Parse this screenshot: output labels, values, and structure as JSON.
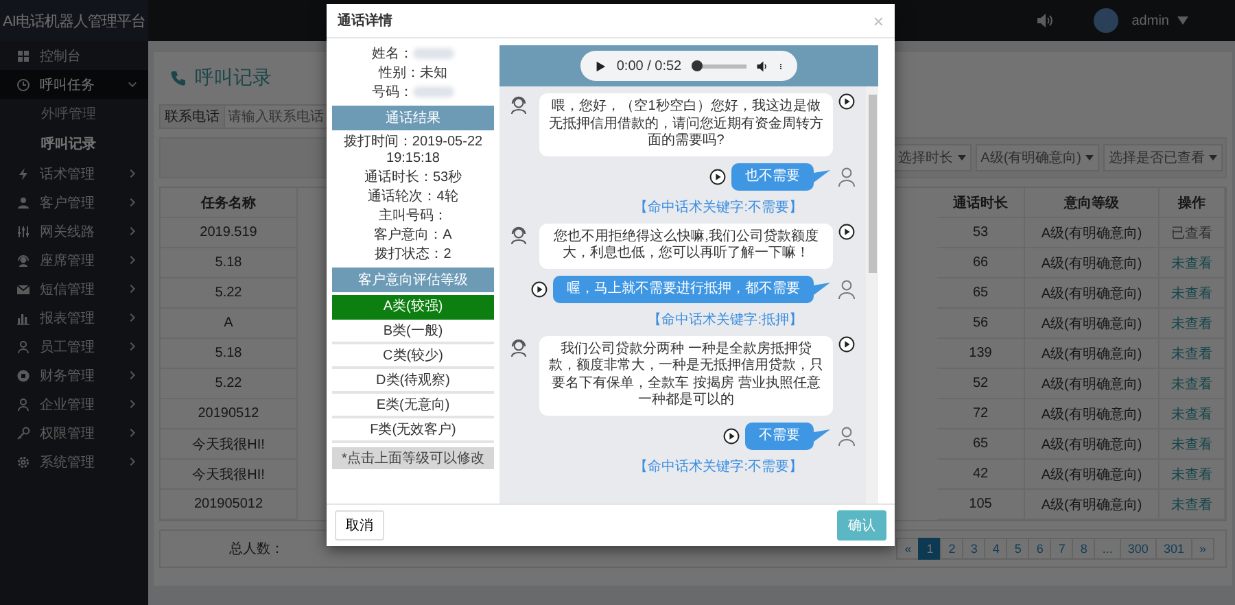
{
  "app": {
    "title": "AI电话机器人管理平台",
    "user": "admin"
  },
  "sidebar": {
    "items": [
      {
        "label": "控制台",
        "kind": "link",
        "selected": false
      },
      {
        "label": "呼叫任务",
        "kind": "menu",
        "selected": true,
        "expanded": true,
        "children": [
          {
            "label": "外呼管理",
            "selected": false
          },
          {
            "label": "呼叫记录",
            "selected": true
          }
        ]
      },
      {
        "label": "话术管理",
        "kind": "menu",
        "selected": false,
        "expanded": false
      },
      {
        "label": "客户管理",
        "kind": "menu",
        "selected": false,
        "expanded": false
      },
      {
        "label": "网关线路",
        "kind": "menu",
        "selected": false,
        "expanded": false
      },
      {
        "label": "座席管理",
        "kind": "menu",
        "selected": false,
        "expanded": false
      },
      {
        "label": "短信管理",
        "kind": "menu",
        "selected": false,
        "expanded": false
      },
      {
        "label": "报表管理",
        "kind": "menu",
        "selected": false,
        "expanded": false
      },
      {
        "label": "员工管理",
        "kind": "menu",
        "selected": false,
        "expanded": false
      },
      {
        "label": "财务管理",
        "kind": "menu",
        "selected": false,
        "expanded": false
      },
      {
        "label": "企业管理",
        "kind": "menu",
        "selected": false,
        "expanded": false
      },
      {
        "label": "权限管理",
        "kind": "menu",
        "selected": false,
        "expanded": false
      },
      {
        "label": "系统管理",
        "kind": "menu",
        "selected": false,
        "expanded": false
      }
    ]
  },
  "page": {
    "title": "呼叫记录",
    "search": {
      "label": "联系电话",
      "placeholder": "请输入联系电话"
    },
    "filters": [
      "选择时长",
      "A级(有明确意向)",
      "选择是否已查看"
    ],
    "table": {
      "columns": {
        "column_1": "任务名称",
        "column_2": "通话时长",
        "column_3": "意向等级",
        "column_4": "操作"
      },
      "rows": [
        {
          "task": "2019.519",
          "duration": "53",
          "level": "A级(有明确意向)",
          "action": "已查看",
          "viewed": true
        },
        {
          "task": "5.18",
          "duration": "66",
          "level": "A级(有明确意向)",
          "action": "未查看",
          "viewed": false
        },
        {
          "task": "5.22",
          "duration": "65",
          "level": "A级(有明确意向)",
          "action": "未查看",
          "viewed": false
        },
        {
          "task": "A",
          "duration": "56",
          "level": "A级(有明确意向)",
          "action": "未查看",
          "viewed": false
        },
        {
          "task": "5.18",
          "duration": "139",
          "level": "A级(有明确意向)",
          "action": "未查看",
          "viewed": false
        },
        {
          "task": "5.22",
          "duration": "52",
          "level": "A级(有明确意向)",
          "action": "未查看",
          "viewed": false
        },
        {
          "task": "20190512",
          "duration": "72",
          "level": "A级(有明确意向)",
          "action": "未查看",
          "viewed": false
        },
        {
          "task": "今天我很HI!",
          "duration": "65",
          "level": "A级(有明确意向)",
          "action": "未查看",
          "viewed": false
        },
        {
          "task": "今天我很HI!",
          "duration": "42",
          "level": "A级(有明确意向)",
          "action": "未查看",
          "viewed": false
        },
        {
          "task": "201905012",
          "duration": "105",
          "level": "A级(有明确意向)",
          "action": "未查看",
          "viewed": false
        }
      ]
    },
    "total_label": "总人数：",
    "pagination": [
      {
        "label": "«",
        "selected": false
      },
      {
        "label": "1",
        "selected": true
      },
      {
        "label": "2",
        "selected": false
      },
      {
        "label": "3",
        "selected": false
      },
      {
        "label": "4",
        "selected": false
      },
      {
        "label": "5",
        "selected": false
      },
      {
        "label": "6",
        "selected": false
      },
      {
        "label": "7",
        "selected": false
      },
      {
        "label": "8",
        "selected": false
      },
      {
        "label": "...",
        "selected": false
      },
      {
        "label": "300",
        "selected": false
      },
      {
        "label": "301",
        "selected": false
      },
      {
        "label": "»",
        "selected": false
      }
    ]
  },
  "dialog": {
    "title": "通话详情",
    "close": "×",
    "contact": [
      {
        "label": "姓名：",
        "blurred": true
      },
      {
        "label": "性别：未知",
        "blurred": false
      },
      {
        "label": "号码：",
        "blurred": true
      }
    ],
    "result_title": "通话结果",
    "result": [
      "拨打时间：2019-05-22 19:15:18",
      "通话时长：53秒",
      "通话轮次：4轮",
      "主叫号码：",
      "客户意向：A",
      "拨打状态：2"
    ],
    "grade_title": "客户意向评估等级",
    "grades": [
      {
        "label": "A类(较强)",
        "selected": true
      },
      {
        "label": "B类(一般)",
        "selected": false
      },
      {
        "label": "C类(较少)",
        "selected": false
      },
      {
        "label": "D类(待观察)",
        "selected": false
      },
      {
        "label": "E类(无意向)",
        "selected": false
      },
      {
        "label": "F类(无效客户)",
        "selected": false
      }
    ],
    "grade_note": "*点击上面等级可以修改",
    "player": {
      "time": "0:00 / 0:52",
      "level": 0
    },
    "messages": [
      {
        "kind": "bot",
        "text": "喂，您好，（空1秒空白）您好，我这边是做无抵押信用借款的，请问您近期有资金周转方面的需要吗?"
      },
      {
        "kind": "user",
        "text": "也不需要"
      },
      {
        "kind": "note",
        "text": "【命中话术关键字:不需要】"
      },
      {
        "kind": "bot",
        "text": "您也不用拒绝得这么快嘛,我们公司贷款额度大，利息也低，您可以再听了解一下嘛！"
      },
      {
        "kind": "user",
        "text": "喔，马上就不需要进行抵押，都不需要"
      },
      {
        "kind": "note",
        "text": "【命中话术关键字:抵押】"
      },
      {
        "kind": "bot",
        "text": "我们公司贷款分两种 一种是全款房抵押贷款，额度非常大，一种是无抵押信用贷款，只要名下有保单，全款车 按揭房 营业执照任意一种都是可以的"
      },
      {
        "kind": "user",
        "text": "不需要"
      },
      {
        "kind": "note",
        "text": "【命中话术关键字:不需要】"
      }
    ],
    "cancel": "取消",
    "confirm": "确认"
  }
}
